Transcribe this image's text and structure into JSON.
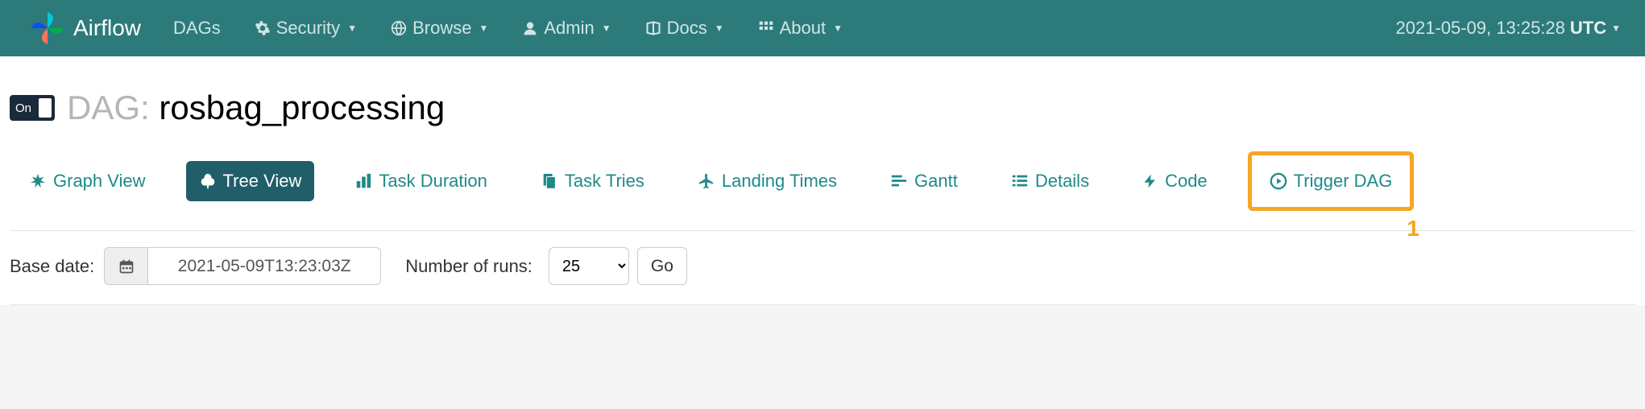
{
  "navbar": {
    "brand": "Airflow",
    "items": [
      {
        "label": "DAGs",
        "icon": null,
        "dropdown": false
      },
      {
        "label": "Security",
        "icon": "gear",
        "dropdown": true
      },
      {
        "label": "Browse",
        "icon": "globe",
        "dropdown": true
      },
      {
        "label": "Admin",
        "icon": "user",
        "dropdown": true
      },
      {
        "label": "Docs",
        "icon": "book",
        "dropdown": true
      },
      {
        "label": "About",
        "icon": "grid",
        "dropdown": true
      }
    ],
    "clock": "2021-05-09, 13:25:28",
    "timezone": "UTC"
  },
  "dag": {
    "toggle_state": "On",
    "title_prefix": "DAG:",
    "title_name": "rosbag_processing"
  },
  "tabs": [
    {
      "label": "Graph View",
      "icon": "burst",
      "active": false
    },
    {
      "label": "Tree View",
      "icon": "tree",
      "active": true
    },
    {
      "label": "Task Duration",
      "icon": "bars",
      "active": false
    },
    {
      "label": "Task Tries",
      "icon": "files",
      "active": false
    },
    {
      "label": "Landing Times",
      "icon": "plane",
      "active": false
    },
    {
      "label": "Gantt",
      "icon": "gantt",
      "active": false
    },
    {
      "label": "Details",
      "icon": "list",
      "active": false
    },
    {
      "label": "Code",
      "icon": "bolt",
      "active": false
    },
    {
      "label": "Trigger DAG",
      "icon": "play-circle",
      "active": false,
      "highlighted": true
    }
  ],
  "annotation": "1",
  "filter": {
    "base_date_label": "Base date:",
    "base_date_value": "2021-05-09T13:23:03Z",
    "runs_label": "Number of runs:",
    "runs_value": "25",
    "go_label": "Go"
  }
}
